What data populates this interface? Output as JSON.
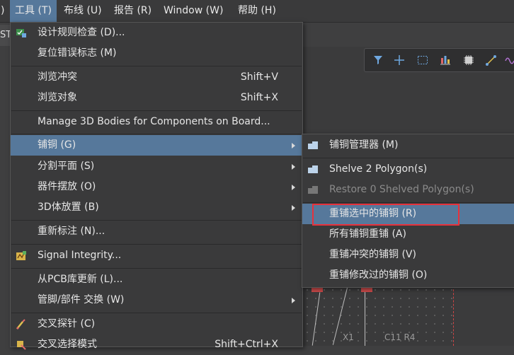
{
  "menubar": {
    "paren": ")",
    "items": [
      "工具 (T)",
      "布线 (U)",
      "报告 (R)",
      "Window (W)",
      "帮助 (H)"
    ]
  },
  "background": {
    "tab_label": "ST",
    "silk_x1": "X1",
    "silk_c11": "C11 R4"
  },
  "main_menu": {
    "items": [
      {
        "label": "设计规则检查 (D)...",
        "shortcut": ""
      },
      {
        "label": "复位错误标志 (M)",
        "shortcut": ""
      },
      {
        "label": "浏览冲突",
        "shortcut": "Shift+V"
      },
      {
        "label": "浏览对象",
        "shortcut": "Shift+X"
      },
      {
        "label": "Manage 3D Bodies for Components on Board...",
        "shortcut": ""
      },
      {
        "label": "铺铜 (G)",
        "shortcut": ""
      },
      {
        "label": "分割平面 (S)",
        "shortcut": ""
      },
      {
        "label": "器件摆放 (O)",
        "shortcut": ""
      },
      {
        "label": "3D体放置 (B)",
        "shortcut": ""
      },
      {
        "label": "重新标注 (N)...",
        "shortcut": ""
      },
      {
        "label": "Signal Integrity...",
        "shortcut": ""
      },
      {
        "label": "从PCB库更新 (L)...",
        "shortcut": ""
      },
      {
        "label": "管脚/部件 交换 (W)",
        "shortcut": ""
      },
      {
        "label": "交叉探针 (C)",
        "shortcut": ""
      },
      {
        "label": "交叉选择模式",
        "shortcut": "Shift+Ctrl+X"
      }
    ]
  },
  "sub_menu": {
    "items": [
      {
        "label": "铺铜管理器 (M)"
      },
      {
        "label": "Shelve 2 Polygon(s)"
      },
      {
        "label": "Restore 0 Shelved Polygon(s)"
      },
      {
        "label": "重铺选中的铺铜 (R)"
      },
      {
        "label": "所有铺铜重铺 (A)"
      },
      {
        "label": "重铺冲突的铺铜 (V)"
      },
      {
        "label": "重铺修改过的铺铜 (O)"
      }
    ]
  },
  "colors": {
    "highlight": "#56789b",
    "menu_bg": "#3a3a3b",
    "annotation_box": "#e8313b"
  }
}
